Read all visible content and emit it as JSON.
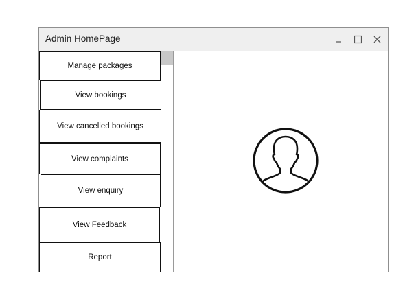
{
  "window": {
    "title": "Admin HomePage",
    "controls": {
      "minimize_icon": "minimize-icon",
      "maximize_icon": "maximize-icon",
      "close_icon": "close-icon"
    }
  },
  "sidebar": {
    "items": [
      {
        "label": "Manage packages"
      },
      {
        "label": "View bookings"
      },
      {
        "label": "View cancelled bookings"
      },
      {
        "label": "View complaints"
      },
      {
        "label": "View enquiry"
      },
      {
        "label": "View Feedback"
      },
      {
        "label": "Report"
      }
    ]
  },
  "content": {
    "avatar_icon": "user-silhouette-icon"
  },
  "colors": {
    "titlebar_bg": "#efefef",
    "border": "#111111",
    "scroll_thumb": "#c8c8c8"
  }
}
